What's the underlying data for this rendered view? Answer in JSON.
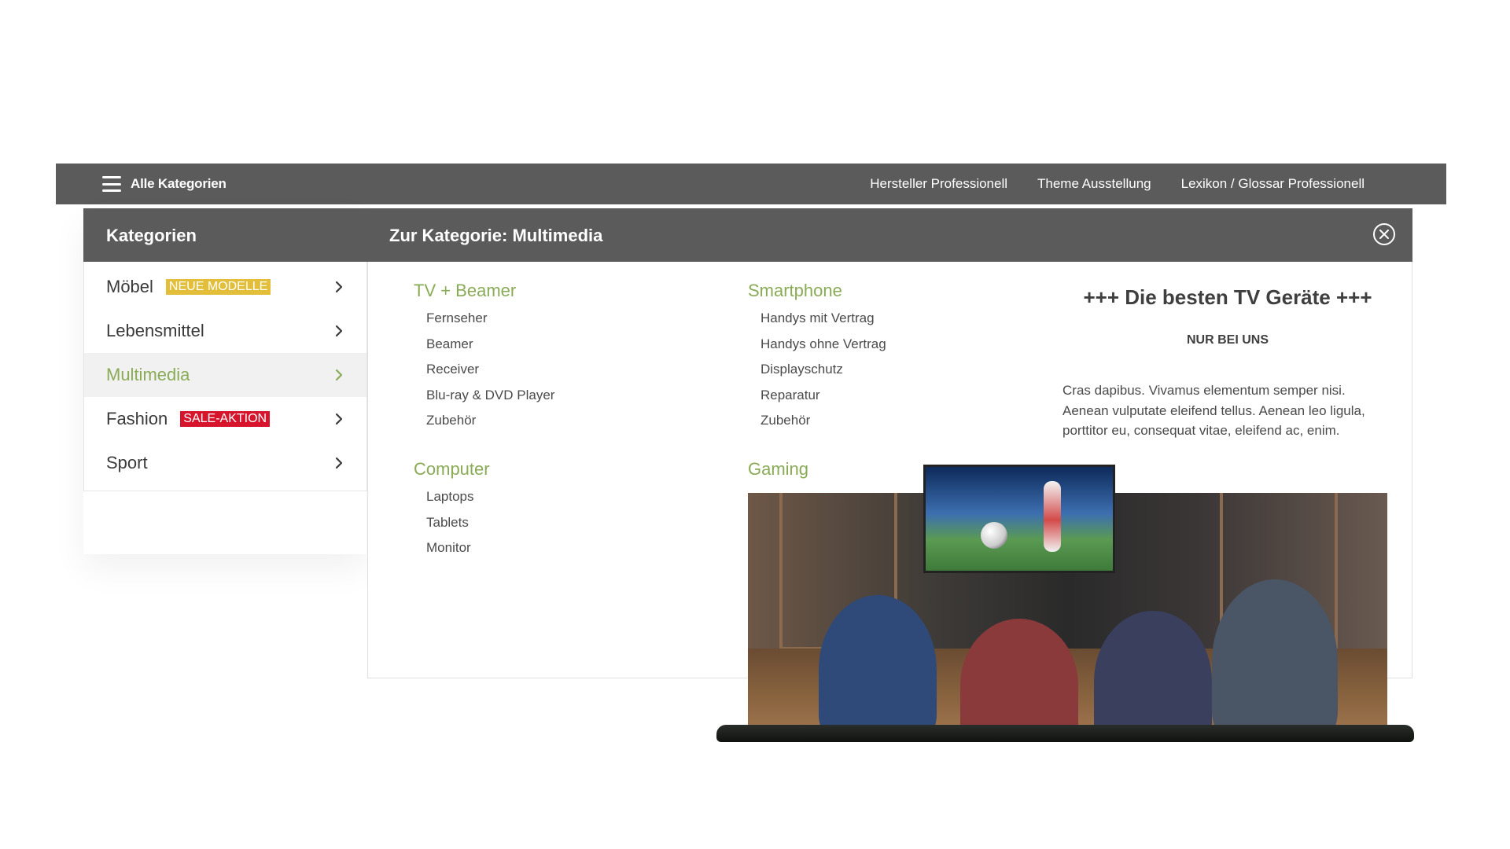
{
  "topbar": {
    "all_categories": "Alle Kategorien",
    "nav": [
      "Hersteller Professionell",
      "Theme Ausstellung",
      "Lexikon / Glossar Professionell"
    ]
  },
  "sidebar": {
    "title": "Kategorien",
    "items": [
      {
        "label": "Möbel",
        "badge": "NEUE MODELLE"
      },
      {
        "label": "Lebensmittel",
        "badge": ""
      },
      {
        "label": "Multimedia",
        "badge": ""
      },
      {
        "label": "Fashion",
        "badge": "SALE-AKTION"
      },
      {
        "label": "Sport",
        "badge": ""
      }
    ]
  },
  "main": {
    "title": "Zur Kategorie: Multimedia",
    "groups": [
      {
        "title": "TV + Beamer",
        "items": [
          "Fernseher",
          "Beamer",
          "Receiver",
          "Blu-ray & DVD Player",
          "Zubehör"
        ]
      },
      {
        "title": "Smartphone",
        "items": [
          "Handys mit Vertrag",
          "Handys ohne Vertrag",
          "Displayschutz",
          "Reparatur",
          "Zubehör"
        ]
      },
      {
        "title": "Computer",
        "items": [
          "Laptops",
          "Tablets",
          "Monitor"
        ]
      },
      {
        "title": "Gaming",
        "items": []
      }
    ],
    "promo": {
      "title": "+++ Die besten TV Geräte +++",
      "subtitle": "NUR BEI UNS",
      "text": "Cras dapibus. Vivamus elementum semper nisi. Aenean vulputate eleifend tellus. Aenean leo ligula, porttitor eu, consequat vitae, eleifend ac, enim."
    }
  },
  "colors": {
    "bar": "#5b5b5b",
    "accent": "#8aab56",
    "badge_yellow": "#e2be3a",
    "badge_red": "#d6152c"
  },
  "icons": {
    "menu": "hamburger-icon",
    "close": "close-circle-icon",
    "chevron": "chevron-right-icon"
  }
}
